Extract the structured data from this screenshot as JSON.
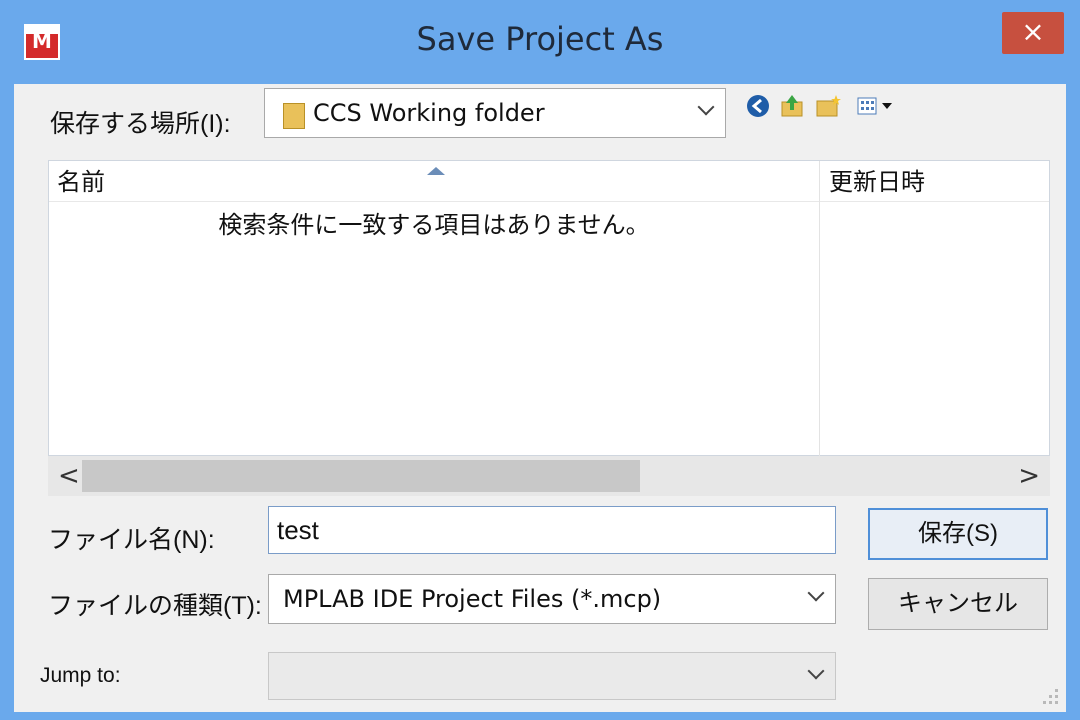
{
  "window": {
    "title": "Save Project As",
    "close_glyph": "×",
    "app_icon_letter": "M"
  },
  "location": {
    "label": "保存する場所(I):",
    "value": "CCS Working folder"
  },
  "toolbar": {
    "icons": [
      "back-icon",
      "up-folder-icon",
      "new-folder-icon",
      "view-menu-icon"
    ]
  },
  "file_list": {
    "col_name": "名前",
    "col_date": "更新日時",
    "empty_message": "検索条件に一致する項目はありません。"
  },
  "scroll": {
    "left": "<",
    "right": ">"
  },
  "filename": {
    "label": "ファイル名(N):",
    "value": "test"
  },
  "filetype": {
    "label": "ファイルの種類(T):",
    "value": "MPLAB IDE Project Files (*.mcp)"
  },
  "jump": {
    "label": "Jump to:",
    "value": ""
  },
  "buttons": {
    "save": "保存(S)",
    "cancel": "キャンセル"
  },
  "colors": {
    "title_bar": "#6aa9ec",
    "close_button": "#c7503f",
    "dialog_bg": "#f0f0f0"
  }
}
